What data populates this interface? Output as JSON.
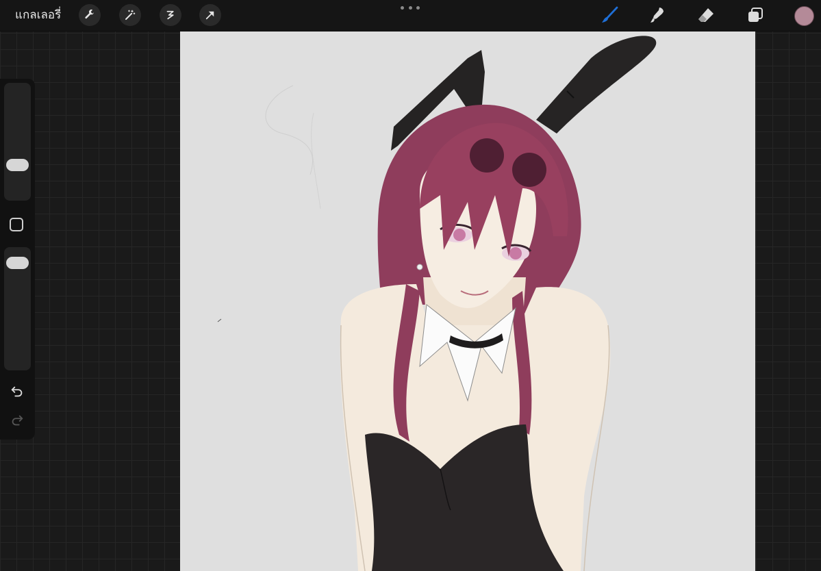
{
  "topbar": {
    "gallery_label": "แกลเลอรี่",
    "left_tools": [
      "wrench-icon",
      "magic-wand-icon",
      "selection-icon",
      "transform-arrow-icon"
    ],
    "more_menu": "ellipsis-icon",
    "right_tools": [
      "brush-icon",
      "smudge-icon",
      "eraser-icon",
      "layers-icon"
    ],
    "active_tool": "brush",
    "active_color": "#b48a98",
    "active_tool_color": "#1f6fd6"
  },
  "sidebar": {
    "brush_size_level": 0.27,
    "opacity_level": 0.93,
    "undo": "undo-icon",
    "redo": "redo-icon"
  },
  "canvas": {
    "background_color": "#dfdfdf",
    "artwork": "illustration"
  }
}
